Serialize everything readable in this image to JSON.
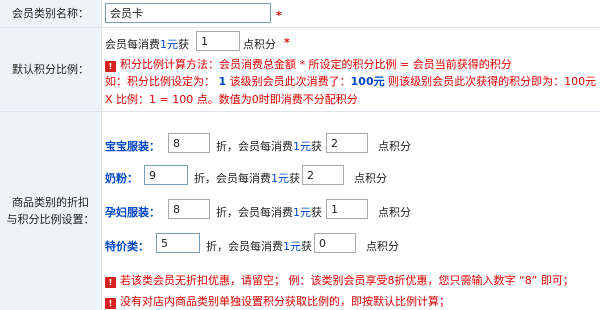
{
  "name_row": {
    "label": "会员类别名称：",
    "value": "会员卡",
    "required": "*"
  },
  "ratio_row": {
    "label": "默认积分比例：",
    "prefix": "会员每消费",
    "amount": "1元",
    "get": "获",
    "value": "1",
    "suffix": "点积分",
    "required": "*",
    "help": {
      "line1": "积分比例计算方法：会员消费总金额 * 所设定的积分比例 = 会员当前获得的积分",
      "line2_a": "如：积分比例设定为：",
      "line2_b": "1",
      "line2_c": "该级别会员此次消费了：",
      "line2_d": "100元",
      "line2_e": "则该级别会员此次获得的积分即为：100元",
      "line3": "X 比例：1 = 100 点。数值为0时即消费不分配积分"
    }
  },
  "category_row": {
    "label_line1": "商品类别的折扣",
    "label_line2": "与积分比例设置：",
    "categories": [
      {
        "name": "宝宝服装：",
        "discount": "8",
        "fold": "折，",
        "prefix": "会员每消费",
        "amount": "1元",
        "get": "获",
        "points": "2",
        "suffix": "点积分"
      },
      {
        "name": "奶粉：",
        "discount": "9",
        "fold": "折，",
        "prefix": "会员每消费",
        "amount": "1元",
        "get": "获",
        "points": "2",
        "suffix": "点积分"
      },
      {
        "name": "孕妇服装：",
        "discount": "8",
        "fold": "折，",
        "prefix": "会员每消费",
        "amount": "1元",
        "get": "获",
        "points": "1",
        "suffix": "点积分"
      },
      {
        "name": "特价类：",
        "discount": "5",
        "fold": "折，",
        "prefix": "会员每消费",
        "amount": "1元",
        "get": "获",
        "points": "0",
        "suffix": "点积分"
      }
    ],
    "notes": {
      "note1": "若该类会员无折扣优惠，请留空；  例：该类别会员享受8折优惠，您只需输入数字 “8” 即可；",
      "note2": "没有对店内商品类别单独设置积分获取比例的，即按默认比例计算；"
    }
  },
  "colors": {
    "label_bg": "#eef3f9",
    "border": "#dde3ec",
    "accent_red": "#e00000",
    "accent_blue": "#0047c8"
  }
}
